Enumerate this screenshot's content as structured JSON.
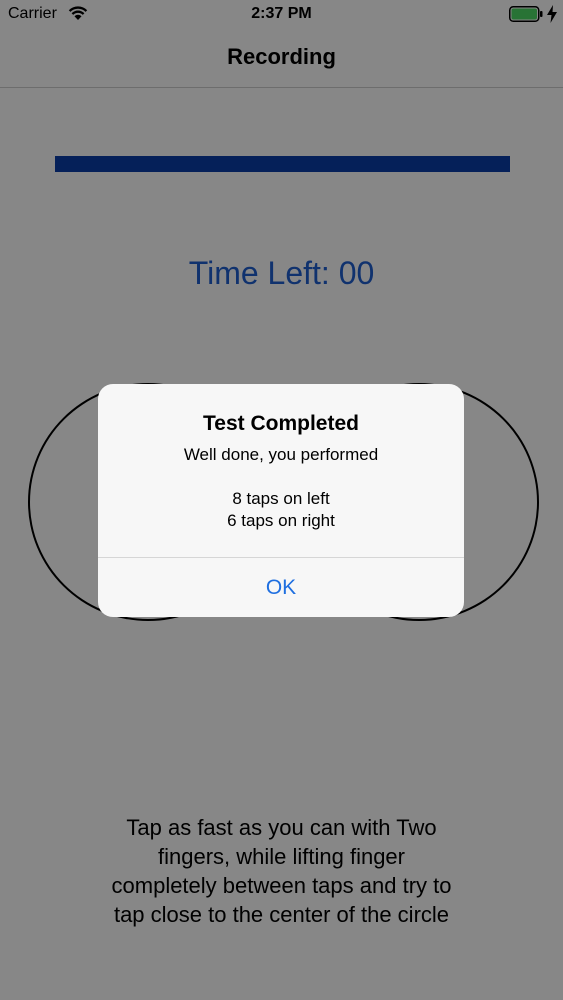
{
  "status_bar": {
    "carrier": "Carrier",
    "time": "2:37 PM",
    "icons": [
      "wifi-icon",
      "battery-icon",
      "charge-icon"
    ]
  },
  "nav": {
    "title": "Recording"
  },
  "progress": {
    "fraction": 1.0,
    "color": "#0a3ea8"
  },
  "timer": {
    "label": "Time Left: 00"
  },
  "instructions": {
    "lines": [
      "Tap as fast as you can with Two",
      "fingers, while lifting finger",
      "completely between taps and try to",
      "tap close to the center of the circle"
    ]
  },
  "alert": {
    "title": "Test Completed",
    "message_line1": "Well done, you performed",
    "left_taps": "8 taps on left",
    "right_taps": "6 taps on right",
    "ok_label": "OK"
  },
  "colors": {
    "accent": "#1f6fe0",
    "timer": "#1f5fd0",
    "battery": "#4cd964"
  }
}
